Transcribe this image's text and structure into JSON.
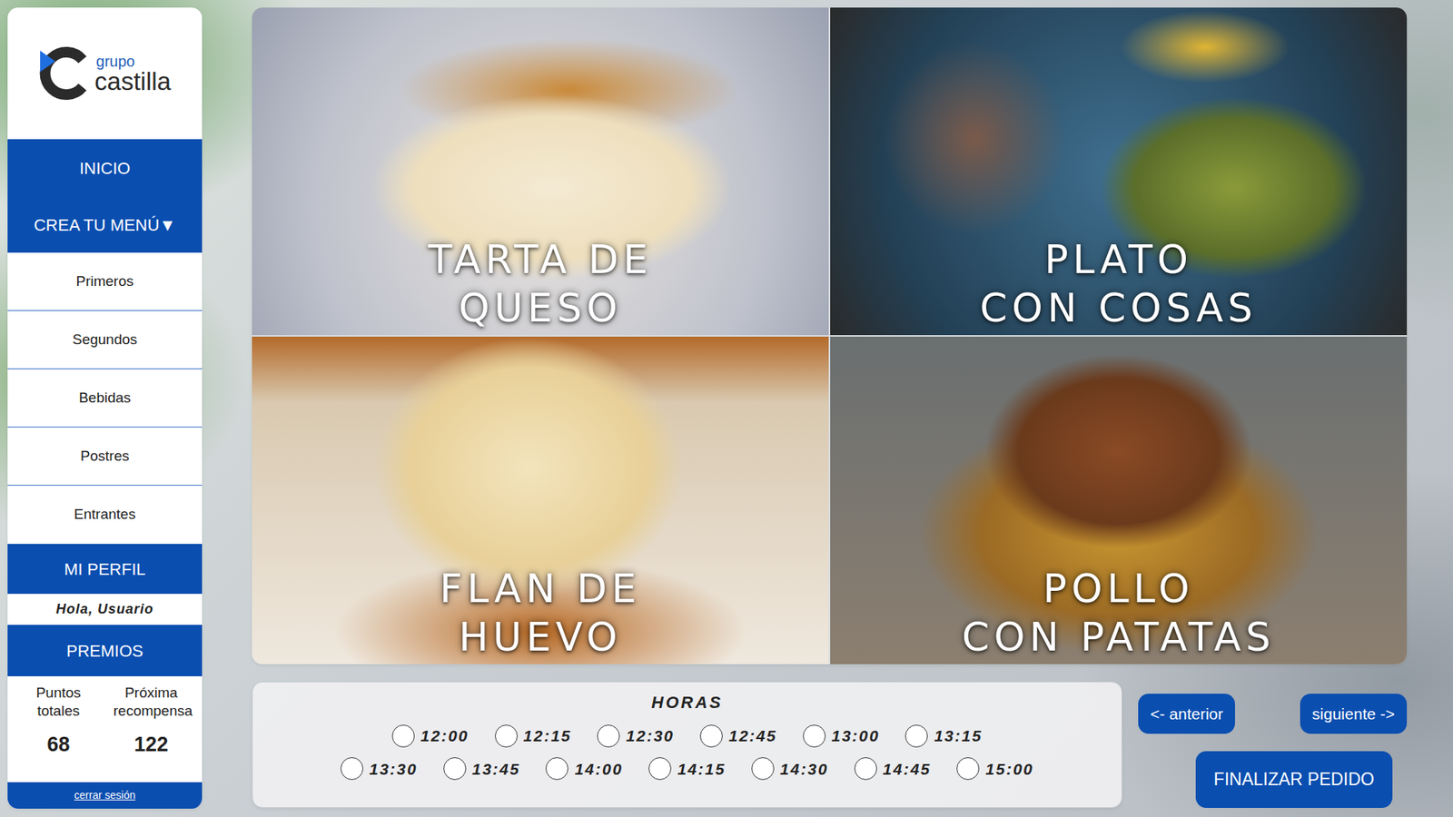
{
  "logo": {
    "small": "grupo",
    "big": "castilla"
  },
  "nav": {
    "home": "INICIO",
    "menu": {
      "label": "CREA TU MENÚ",
      "arrow": "▼",
      "expanded": true,
      "items": [
        "Primeros",
        "Segundos",
        "Bebidas",
        "Postres",
        "Entrantes"
      ]
    },
    "profile": {
      "label": "MI PERFIL",
      "greeting": "Hola, Usuario"
    },
    "rewards": {
      "label": "PREMIOS",
      "stats": [
        {
          "label": "Puntos totales",
          "value": "68"
        },
        {
          "label": "Próxima recompensa",
          "value": "122"
        }
      ]
    },
    "logout": "cerrar sesión"
  },
  "dishes": [
    {
      "lines": [
        "TARTA DE",
        "QUESO"
      ]
    },
    {
      "lines": [
        "PLATO",
        "CON COSAS"
      ]
    },
    {
      "lines": [
        "FLAN DE",
        "HUEVO"
      ]
    },
    {
      "lines": [
        "POLLO",
        "CON PATATAS"
      ]
    }
  ],
  "hours": {
    "title": "HORAS",
    "rows": [
      [
        {
          "time": "12:00",
          "selected": false
        },
        {
          "time": "12:15",
          "selected": false
        },
        {
          "time": "12:30",
          "selected": false
        },
        {
          "time": "12:45",
          "selected": false
        },
        {
          "time": "13:00",
          "selected": false
        },
        {
          "time": "13:15",
          "selected": false
        }
      ],
      [
        {
          "time": "13:30",
          "selected": false
        },
        {
          "time": "13:45",
          "selected": false
        },
        {
          "time": "14:00",
          "selected": false
        },
        {
          "time": "14:15",
          "selected": false
        },
        {
          "time": "14:30",
          "selected": false
        },
        {
          "time": "14:45",
          "selected": false
        },
        {
          "time": "15:00",
          "selected": false
        }
      ]
    ]
  },
  "buttons": {
    "prev": "<- anterior",
    "next": "siguiente ->",
    "finish": "FINALIZAR PEDIDO"
  }
}
